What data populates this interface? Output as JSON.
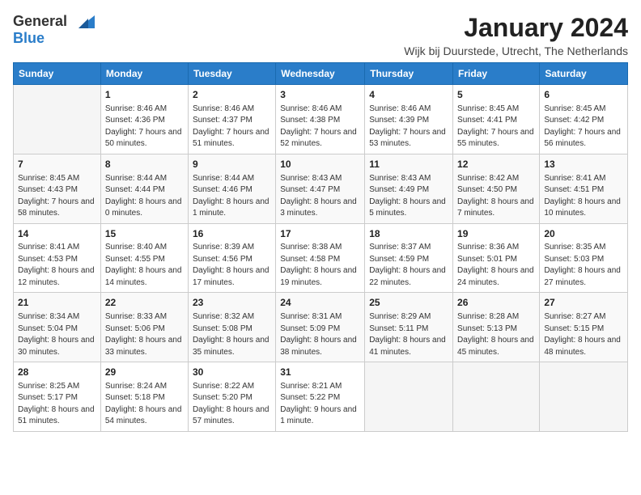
{
  "header": {
    "logo_general": "General",
    "logo_blue": "Blue",
    "title": "January 2024",
    "subtitle": "Wijk bij Duurstede, Utrecht, The Netherlands"
  },
  "days_of_week": [
    "Sunday",
    "Monday",
    "Tuesday",
    "Wednesday",
    "Thursday",
    "Friday",
    "Saturday"
  ],
  "weeks": [
    [
      {
        "num": "",
        "sunrise": "",
        "sunset": "",
        "daylight": ""
      },
      {
        "num": "1",
        "sunrise": "Sunrise: 8:46 AM",
        "sunset": "Sunset: 4:36 PM",
        "daylight": "Daylight: 7 hours and 50 minutes."
      },
      {
        "num": "2",
        "sunrise": "Sunrise: 8:46 AM",
        "sunset": "Sunset: 4:37 PM",
        "daylight": "Daylight: 7 hours and 51 minutes."
      },
      {
        "num": "3",
        "sunrise": "Sunrise: 8:46 AM",
        "sunset": "Sunset: 4:38 PM",
        "daylight": "Daylight: 7 hours and 52 minutes."
      },
      {
        "num": "4",
        "sunrise": "Sunrise: 8:46 AM",
        "sunset": "Sunset: 4:39 PM",
        "daylight": "Daylight: 7 hours and 53 minutes."
      },
      {
        "num": "5",
        "sunrise": "Sunrise: 8:45 AM",
        "sunset": "Sunset: 4:41 PM",
        "daylight": "Daylight: 7 hours and 55 minutes."
      },
      {
        "num": "6",
        "sunrise": "Sunrise: 8:45 AM",
        "sunset": "Sunset: 4:42 PM",
        "daylight": "Daylight: 7 hours and 56 minutes."
      }
    ],
    [
      {
        "num": "7",
        "sunrise": "Sunrise: 8:45 AM",
        "sunset": "Sunset: 4:43 PM",
        "daylight": "Daylight: 7 hours and 58 minutes."
      },
      {
        "num": "8",
        "sunrise": "Sunrise: 8:44 AM",
        "sunset": "Sunset: 4:44 PM",
        "daylight": "Daylight: 8 hours and 0 minutes."
      },
      {
        "num": "9",
        "sunrise": "Sunrise: 8:44 AM",
        "sunset": "Sunset: 4:46 PM",
        "daylight": "Daylight: 8 hours and 1 minute."
      },
      {
        "num": "10",
        "sunrise": "Sunrise: 8:43 AM",
        "sunset": "Sunset: 4:47 PM",
        "daylight": "Daylight: 8 hours and 3 minutes."
      },
      {
        "num": "11",
        "sunrise": "Sunrise: 8:43 AM",
        "sunset": "Sunset: 4:49 PM",
        "daylight": "Daylight: 8 hours and 5 minutes."
      },
      {
        "num": "12",
        "sunrise": "Sunrise: 8:42 AM",
        "sunset": "Sunset: 4:50 PM",
        "daylight": "Daylight: 8 hours and 7 minutes."
      },
      {
        "num": "13",
        "sunrise": "Sunrise: 8:41 AM",
        "sunset": "Sunset: 4:51 PM",
        "daylight": "Daylight: 8 hours and 10 minutes."
      }
    ],
    [
      {
        "num": "14",
        "sunrise": "Sunrise: 8:41 AM",
        "sunset": "Sunset: 4:53 PM",
        "daylight": "Daylight: 8 hours and 12 minutes."
      },
      {
        "num": "15",
        "sunrise": "Sunrise: 8:40 AM",
        "sunset": "Sunset: 4:55 PM",
        "daylight": "Daylight: 8 hours and 14 minutes."
      },
      {
        "num": "16",
        "sunrise": "Sunrise: 8:39 AM",
        "sunset": "Sunset: 4:56 PM",
        "daylight": "Daylight: 8 hours and 17 minutes."
      },
      {
        "num": "17",
        "sunrise": "Sunrise: 8:38 AM",
        "sunset": "Sunset: 4:58 PM",
        "daylight": "Daylight: 8 hours and 19 minutes."
      },
      {
        "num": "18",
        "sunrise": "Sunrise: 8:37 AM",
        "sunset": "Sunset: 4:59 PM",
        "daylight": "Daylight: 8 hours and 22 minutes."
      },
      {
        "num": "19",
        "sunrise": "Sunrise: 8:36 AM",
        "sunset": "Sunset: 5:01 PM",
        "daylight": "Daylight: 8 hours and 24 minutes."
      },
      {
        "num": "20",
        "sunrise": "Sunrise: 8:35 AM",
        "sunset": "Sunset: 5:03 PM",
        "daylight": "Daylight: 8 hours and 27 minutes."
      }
    ],
    [
      {
        "num": "21",
        "sunrise": "Sunrise: 8:34 AM",
        "sunset": "Sunset: 5:04 PM",
        "daylight": "Daylight: 8 hours and 30 minutes."
      },
      {
        "num": "22",
        "sunrise": "Sunrise: 8:33 AM",
        "sunset": "Sunset: 5:06 PM",
        "daylight": "Daylight: 8 hours and 33 minutes."
      },
      {
        "num": "23",
        "sunrise": "Sunrise: 8:32 AM",
        "sunset": "Sunset: 5:08 PM",
        "daylight": "Daylight: 8 hours and 35 minutes."
      },
      {
        "num": "24",
        "sunrise": "Sunrise: 8:31 AM",
        "sunset": "Sunset: 5:09 PM",
        "daylight": "Daylight: 8 hours and 38 minutes."
      },
      {
        "num": "25",
        "sunrise": "Sunrise: 8:29 AM",
        "sunset": "Sunset: 5:11 PM",
        "daylight": "Daylight: 8 hours and 41 minutes."
      },
      {
        "num": "26",
        "sunrise": "Sunrise: 8:28 AM",
        "sunset": "Sunset: 5:13 PM",
        "daylight": "Daylight: 8 hours and 45 minutes."
      },
      {
        "num": "27",
        "sunrise": "Sunrise: 8:27 AM",
        "sunset": "Sunset: 5:15 PM",
        "daylight": "Daylight: 8 hours and 48 minutes."
      }
    ],
    [
      {
        "num": "28",
        "sunrise": "Sunrise: 8:25 AM",
        "sunset": "Sunset: 5:17 PM",
        "daylight": "Daylight: 8 hours and 51 minutes."
      },
      {
        "num": "29",
        "sunrise": "Sunrise: 8:24 AM",
        "sunset": "Sunset: 5:18 PM",
        "daylight": "Daylight: 8 hours and 54 minutes."
      },
      {
        "num": "30",
        "sunrise": "Sunrise: 8:22 AM",
        "sunset": "Sunset: 5:20 PM",
        "daylight": "Daylight: 8 hours and 57 minutes."
      },
      {
        "num": "31",
        "sunrise": "Sunrise: 8:21 AM",
        "sunset": "Sunset: 5:22 PM",
        "daylight": "Daylight: 9 hours and 1 minute."
      },
      {
        "num": "",
        "sunrise": "",
        "sunset": "",
        "daylight": ""
      },
      {
        "num": "",
        "sunrise": "",
        "sunset": "",
        "daylight": ""
      },
      {
        "num": "",
        "sunrise": "",
        "sunset": "",
        "daylight": ""
      }
    ]
  ]
}
